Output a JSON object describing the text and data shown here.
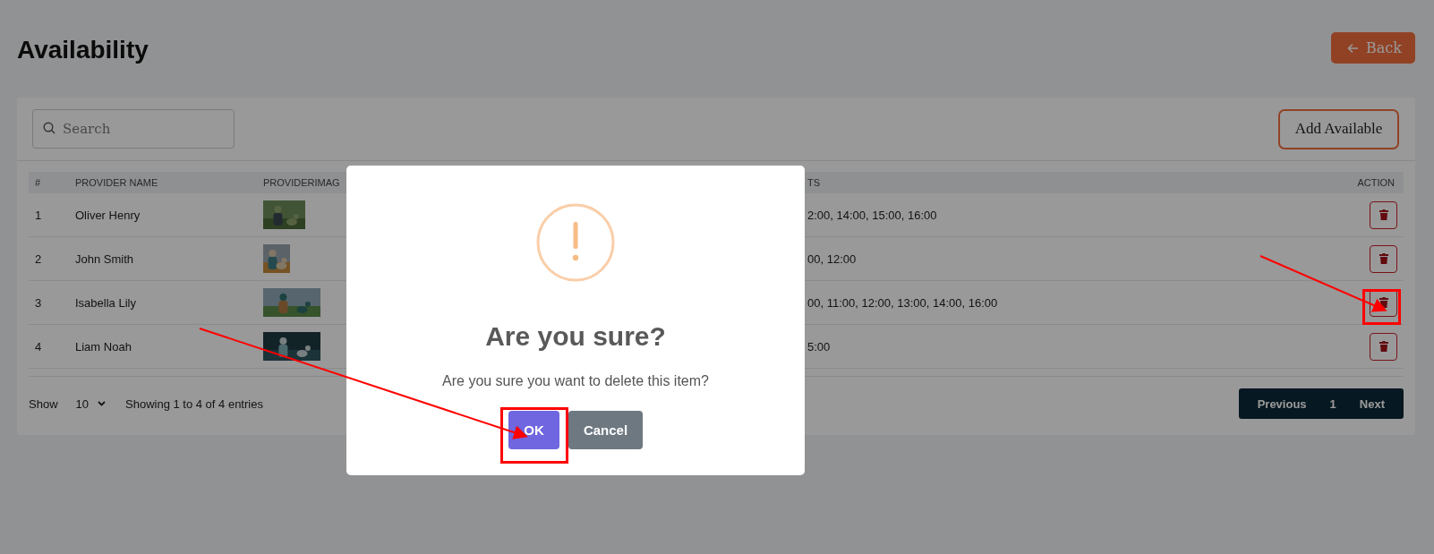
{
  "page": {
    "title": "Availability",
    "back_button": "Back"
  },
  "toolbar": {
    "search": {
      "placeholder": "Search"
    },
    "add_button": "Add Available"
  },
  "table": {
    "columns": [
      "#",
      "PROVIDER NAME",
      "PROVIDERIMAG",
      "TS",
      "ACTION"
    ],
    "rows": [
      {
        "number": "1",
        "name": "Oliver Henry",
        "slots": "2:00, 14:00, 15:00, 16:00"
      },
      {
        "number": "2",
        "name": "John Smith",
        "slots": "00, 12:00"
      },
      {
        "number": "3",
        "name": "Isabella Lily",
        "slots": "00, 11:00, 12:00, 13:00, 14:00, 16:00"
      },
      {
        "number": "4",
        "name": "Liam Noah",
        "slots": "5:00"
      }
    ]
  },
  "footer": {
    "show_label": "Show",
    "page_size": "10",
    "info": "Showing 1 to 4 of 4 entries",
    "pagination": [
      "Previous",
      "1",
      "Next"
    ]
  },
  "dialog": {
    "title": "Are you sure?",
    "message": "Are you sure you want to delete this item?",
    "ok_button": "OK",
    "cancel_button": "Cancel"
  }
}
